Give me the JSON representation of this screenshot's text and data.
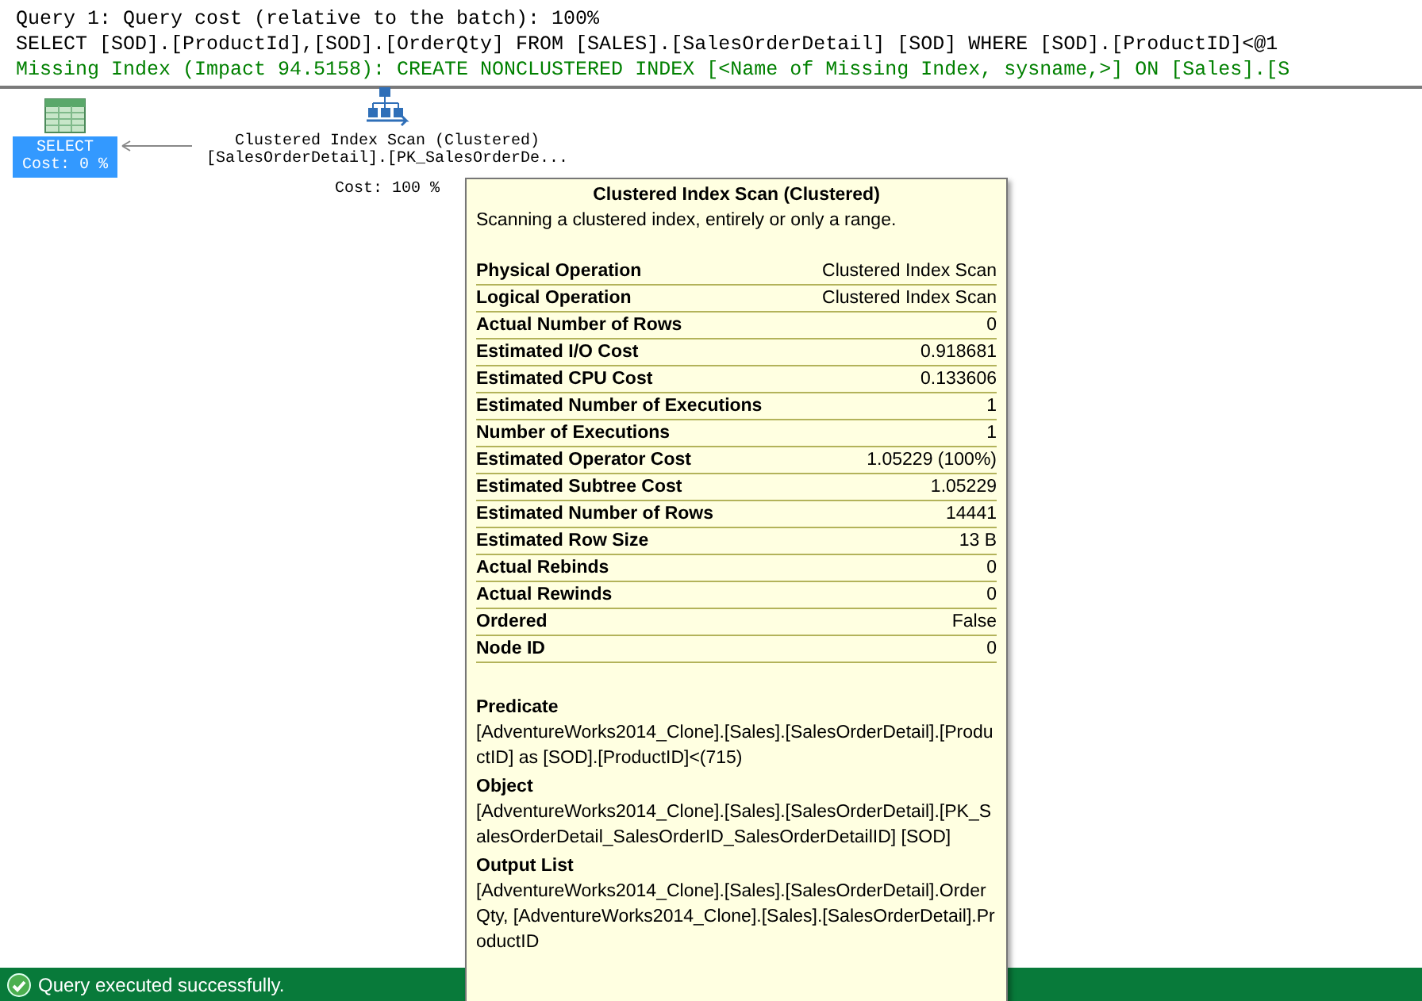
{
  "header": {
    "lines": [
      {
        "kind": "plain",
        "text": "Query 1: Query cost (relative to the batch): 100%"
      },
      {
        "kind": "plain",
        "text": "SELECT [SOD].[ProductId],[SOD].[OrderQty] FROM [SALES].[SalesOrderDetail] [SOD] WHERE [SOD].[ProductID]<@1"
      },
      {
        "kind": "hint",
        "text": "Missing Index (Impact 94.5158): CREATE NONCLUSTERED INDEX [<Name of Missing Index, sysname,>] ON [Sales].[S"
      }
    ]
  },
  "plan": {
    "nodes": [
      {
        "kind": "select",
        "label": "SELECT",
        "cost": "Cost: 0 %",
        "selected": true
      },
      {
        "kind": "scan",
        "label": "Clustered Index Scan (Clustered)",
        "object": "[SalesOrderDetail].[PK_SalesOrderDe...",
        "cost": "Cost: 100 %",
        "selected": false
      }
    ]
  },
  "tooltip": {
    "title": "Clustered Index Scan (Clustered)",
    "description": "Scanning a clustered index, entirely or only a range.",
    "properties": [
      {
        "name": "Physical Operation",
        "value": "Clustered Index Scan"
      },
      {
        "name": "Logical Operation",
        "value": "Clustered Index Scan"
      },
      {
        "name": "Actual Number of Rows",
        "value": "0"
      },
      {
        "name": "Estimated I/O Cost",
        "value": "0.918681"
      },
      {
        "name": "Estimated CPU Cost",
        "value": "0.133606"
      },
      {
        "name": "Estimated Number of Executions",
        "value": "1"
      },
      {
        "name": "Number of Executions",
        "value": "1"
      },
      {
        "name": "Estimated Operator Cost",
        "value": "1.05229 (100%)"
      },
      {
        "name": "Estimated Subtree Cost",
        "value": "1.05229"
      },
      {
        "name": "Estimated Number of Rows",
        "value": "14441"
      },
      {
        "name": "Estimated Row Size",
        "value": "13 B"
      },
      {
        "name": "Actual Rebinds",
        "value": "0"
      },
      {
        "name": "Actual Rewinds",
        "value": "0"
      },
      {
        "name": "Ordered",
        "value": "False"
      },
      {
        "name": "Node ID",
        "value": "0"
      }
    ],
    "sections": [
      {
        "heading": "Predicate",
        "text": "[AdventureWorks2014_Clone].[Sales].[SalesOrderDetail].[ProductID] as [SOD].[ProductID]<(715)"
      },
      {
        "heading": "Object",
        "text": "[AdventureWorks2014_Clone].[Sales].[SalesOrderDetail].[PK_SalesOrderDetail_SalesOrderID_SalesOrderDetailID] [SOD]"
      },
      {
        "heading": "Output List",
        "text": "[AdventureWorks2014_Clone].[Sales].[SalesOrderDetail].OrderQty, [AdventureWorks2014_Clone].[Sales].[SalesOrderDetail].ProductID"
      }
    ]
  },
  "status_bar": {
    "message": "Query executed successfully."
  }
}
